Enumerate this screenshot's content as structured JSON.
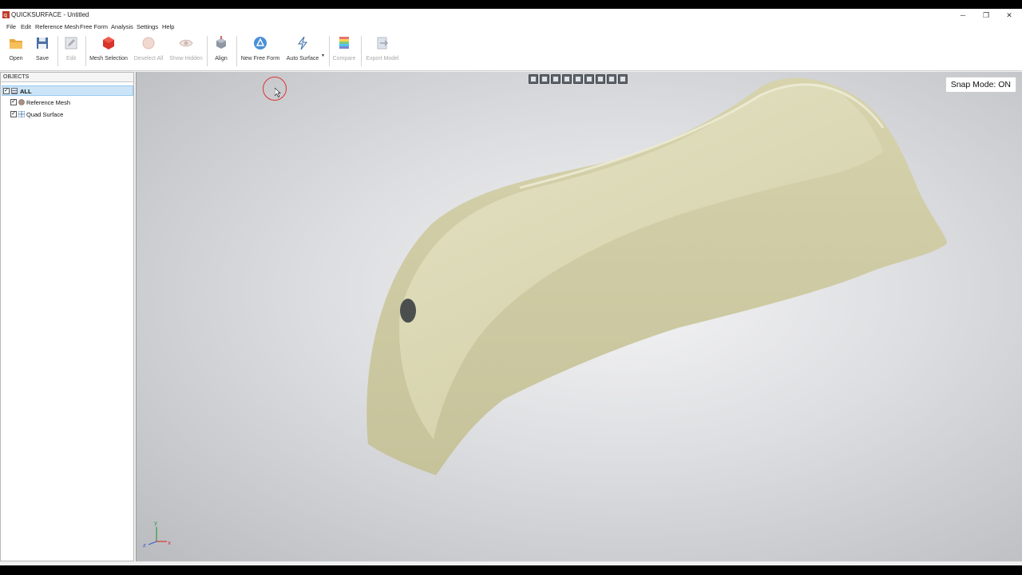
{
  "window": {
    "title": "QUICKSURFACE - Untitled",
    "minimize": "─",
    "restore": "❐",
    "close": "✕"
  },
  "menu": [
    "File",
    "Edit",
    "Reference Mesh",
    "Free Form",
    "Analysis",
    "Settings",
    "Help"
  ],
  "toolbar": {
    "open": "Open",
    "save": "Save",
    "edit": "Edit",
    "mesh_selection": "Mesh Selection",
    "deselect_all": "Deselect All",
    "show_hidden": "Show Hidden",
    "align": "Align",
    "new_free_form": "New Free Form",
    "auto_surface": "Auto Surface",
    "compare": "Compare",
    "export_model": "Export Model"
  },
  "objects_panel": {
    "header": "OBJECTS",
    "items": [
      {
        "label": "ALL",
        "checked": true,
        "selected": true
      },
      {
        "label": "Reference Mesh",
        "checked": true,
        "selected": false
      },
      {
        "label": "Quad Surface",
        "checked": true,
        "selected": false
      }
    ]
  },
  "viewport": {
    "snap_mode": "Snap Mode: ON",
    "axis": {
      "y": "y",
      "z": "z",
      "x": "x"
    },
    "mesh_color": "#d6d3ad"
  },
  "colors": {
    "accent": "#cce4f7",
    "mesh_selection_icon": "#d9342b",
    "new_free_form_icon": "#4a90d9"
  }
}
